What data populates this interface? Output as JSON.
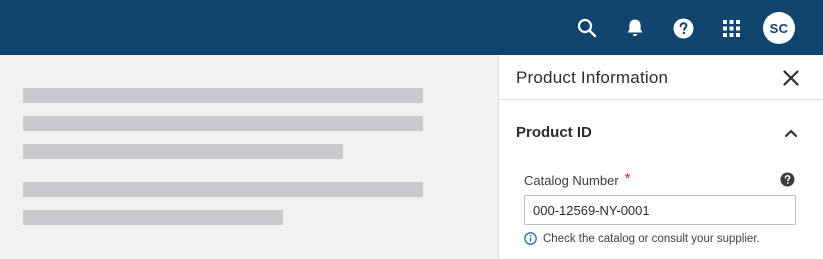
{
  "topbar": {
    "icons": [
      "search-icon",
      "bell-icon",
      "help-icon",
      "apps-grid-icon"
    ],
    "avatar_initials": "SC",
    "color": "#0f446f"
  },
  "panel": {
    "title": "Product Information",
    "section": {
      "title": "Product ID",
      "field": {
        "label": "Catalog Number",
        "required_marker": "*",
        "value": "000-12569-NY-0001",
        "hint": "Check the catalog or consult your supplier."
      }
    }
  }
}
